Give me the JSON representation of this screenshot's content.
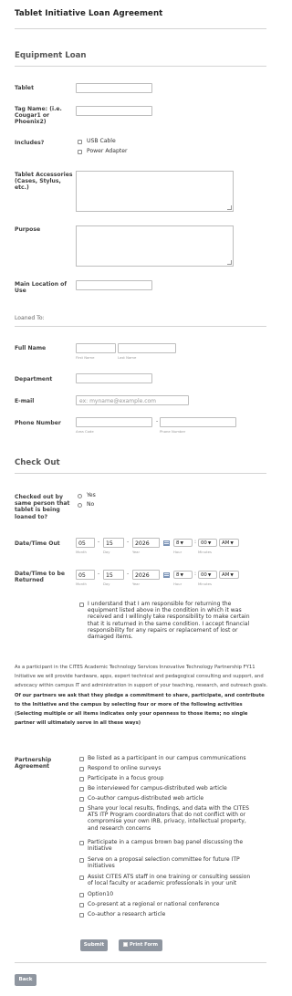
{
  "page_title": "Tablet Initiative Loan Agreement",
  "sections": {
    "equipment_loan": "Equipment Loan",
    "loaned_to": "Loaned To:",
    "check_out": "Check Out"
  },
  "fields": {
    "tablet": "Tablet",
    "tag_name": "Tag Name: (i.e. Cougar1 or Phoenix2)",
    "includes": "Includes?",
    "includes_options": [
      "USB Cable",
      "Power Adapter"
    ],
    "accessories": "Tablet Accessories (Cases, Stylus, etc.)",
    "purpose": "Purpose",
    "main_location": "Main Location of Use",
    "full_name": "Full Name",
    "first_name_sub": "First Name",
    "last_name_sub": "Last Name",
    "department": "Department",
    "email": "E-mail",
    "email_placeholder": "ex: myname@example.com",
    "phone": "Phone Number",
    "area_code_sub": "Area Code",
    "phone_number_sub": "Phone Number",
    "checked_out_same": "Checked out by same person that tablet is being loaned to?",
    "yes": "Yes",
    "no": "No",
    "datetime_out": "Date/Time Out",
    "datetime_returned": "Date/Time to be Returned",
    "responsibility": "I understand that I am responsible for returning the equipment listed above in the condition in which it was received and I willingly take responsibility to make certain that it is returned in the same condition. I accept financial responsibility for any repairs or replacement of lost or damaged items.",
    "partnership": "Partnership Agreement"
  },
  "date_out": {
    "month": "05",
    "day": "15",
    "year": "2026",
    "hour": "8",
    "minutes": "00",
    "ampm": "AM"
  },
  "date_returned": {
    "month": "05",
    "day": "15",
    "year": "2026",
    "hour": "8",
    "minutes": "00",
    "ampm": "AM"
  },
  "date_subs": {
    "month": "Month",
    "day": "Day",
    "year": "Year",
    "hour": "Hour",
    "minutes": "Minutes"
  },
  "intro_paragraph": {
    "normal": "As a participant in the CITES Academic Technology Services Innovative Technology Partnership FY11 Initiative we will provide hardware, apps, expert technical and pedagogical consulting and support, and advocacy within campus IT and administration in support of your teaching, research, and outreach goals.",
    "bold": "Of our partners we ask that they pledge a commitment to share, participate, and contribute to the Initiative and the campus by selecting four or more of the following activities (Selecting multiple or all items indicates only your openness to those items; no single partner will ultimately serve in all these ways)"
  },
  "partnership_options": [
    "Be listed as a participant in our campus communications",
    "Respond to online surveys",
    "Participate in a focus group",
    "Be interviewed for campus-distributed web article",
    "Co-author campus-distributed web article",
    "Share your local results, findings, and data with the CITES ATS ITP Program coordinators that do not conflict with or compromise your own IRB, privacy, intellectual property, and research concerns",
    "Participate in a campus brown bag panel discussing the Initiative",
    "Serve on a proposal selection committee for future ITP Initiatives",
    "Assist CITES ATS staff in one training or consulting session of local faculty or academic professionals in your unit",
    "Option10",
    "Co-present at a regional or national conference",
    "Co-author a research article"
  ],
  "buttons": {
    "submit": "Submit",
    "print": "Print Form",
    "back": "Back"
  }
}
